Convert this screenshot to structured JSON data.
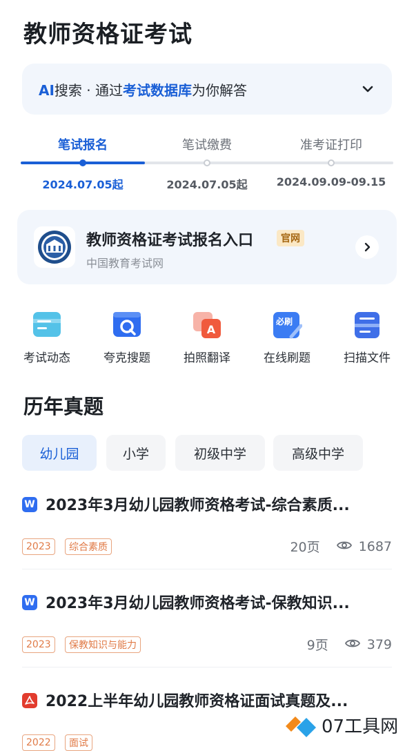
{
  "header": {
    "title": "教师资格证考试"
  },
  "ai_search": {
    "prefix": "AI",
    "text1": "搜索 · 通过",
    "highlight": "考试数据库",
    "text2": "为你解答"
  },
  "steps": [
    {
      "label": "笔试报名",
      "date": "2024.07.05起",
      "active": true
    },
    {
      "label": "笔试缴费",
      "date": "2024.07.05起",
      "active": false
    },
    {
      "label": "准考证打印",
      "date": "2024.09.09-09.15",
      "active": false
    }
  ],
  "entry": {
    "title": "教师资格证考试报名入口",
    "badge": "官网",
    "subtitle": "中国教育考试网"
  },
  "tools": [
    {
      "label": "考试动态",
      "icon": "news-icon"
    },
    {
      "label": "夸克搜题",
      "icon": "search-question-icon"
    },
    {
      "label": "拍照翻译",
      "icon": "photo-translate-icon"
    },
    {
      "label": "在线刷题",
      "icon": "practice-icon",
      "icon_text": "必刷"
    },
    {
      "label": "扫描文件",
      "icon": "scan-document-icon"
    }
  ],
  "section": {
    "title": "历年真题"
  },
  "tabs": [
    {
      "label": "幼儿园",
      "active": true
    },
    {
      "label": "小学",
      "active": false
    },
    {
      "label": "初级中学",
      "active": false
    },
    {
      "label": "高级中学",
      "active": false
    }
  ],
  "documents": [
    {
      "type": "W",
      "title": "2023年3月幼儿园教师资格考试-综合素质...",
      "tags": [
        "2023",
        "综合素质"
      ],
      "pages": "20页",
      "views": "1687"
    },
    {
      "type": "W",
      "title": "2023年3月幼儿园教师资格考试-保教知识...",
      "tags": [
        "2023",
        "保教知识与能力"
      ],
      "pages": "9页",
      "views": "379"
    },
    {
      "type": "PDF",
      "title": "2022上半年幼儿园教师资格证面试真题及...",
      "tags": [
        "2022",
        "面试"
      ],
      "pages": "",
      "views": ""
    }
  ],
  "watermark": {
    "text": "07工具网"
  },
  "colors": {
    "accent": "#1a5fd6",
    "tag": "#e07a46",
    "card_bg": "#f2f6fc"
  }
}
